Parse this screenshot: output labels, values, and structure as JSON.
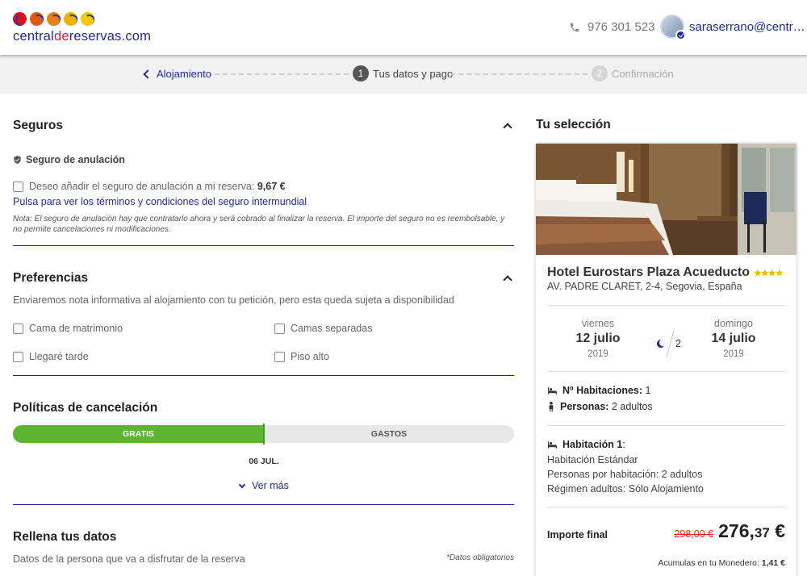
{
  "header": {
    "logo_text_a": "central",
    "logo_text_b": "de",
    "logo_text_c": "reservas.com",
    "phone": "976 301 523",
    "user_email": "saraserrano@centr…"
  },
  "steps": {
    "back_label": "Alojamiento",
    "step1_num": "1",
    "step1_label": "Tus datos y pago",
    "step2_num": "2",
    "step2_label": "Confirmación"
  },
  "seguros": {
    "title": "Seguros",
    "subtitle": "Seguro de anulación",
    "checkbox_label": "Deseo añadir el seguro de anulación a mi reserva:",
    "price": "9,67 €",
    "terms_link": "Pulsa para ver los términos y condiciones del seguro intermundial",
    "note": "Nota: El seguro de anulación hay que contratarlo ahora y será cobrado al finalizar la reserva. El importe del seguro no es reembolsable, y no permite cancelaciones ni modificaciones."
  },
  "preferencias": {
    "title": "Preferencias",
    "description": "Enviaremos nota informativa al alojamiento con tu petición, pero esta queda sujeta a disponibilidad",
    "options": [
      "Cama de matrimonio",
      "Camas separadas",
      "Llegaré tarde",
      "Piso alto"
    ]
  },
  "cancelacion": {
    "title": "Políticas de cancelación",
    "free_label": "GRATIS",
    "cost_label": "GASTOS",
    "free_fraction": 0.5,
    "split_date": "06 JUL.",
    "more_link": "Ver más"
  },
  "datos": {
    "title": "Rellena tus datos",
    "description": "Datos de la persona que va a disfrutar de la reserva",
    "required_note": "*Datos obligatorios"
  },
  "seleccion": {
    "title": "Tu selección",
    "hotel_name": "Hotel Eurostars Plaza Acueducto",
    "stars": "★★★★",
    "star_count": 4,
    "address": "AV. PADRE CLARET, 2-4, Segovia, España",
    "checkin_weekday": "viernes",
    "checkin_date": "12 julio",
    "checkin_year": "2019",
    "nights": "2",
    "checkout_weekday": "domingo",
    "checkout_date": "14 julio",
    "checkout_year": "2019",
    "rooms_label": "Nº Habitaciones:",
    "rooms_value": "1",
    "persons_label": "Personas:",
    "persons_value": "2 adultos",
    "room1_label": "Habitación 1",
    "room1_type": "Habitación Estándar",
    "room1_persons": "Personas por habitación: 2 adultos",
    "room1_regime": "Régimen adultos: Sólo Alojamiento",
    "final_label": "Importe final",
    "old_price": "298,00 €",
    "price_int": "276,",
    "price_dec": "37",
    "price_cur": "€",
    "wallet_label": "Acumulas en tu Monedero:",
    "wallet_value": "1,41 €"
  },
  "colors": {
    "brand_blue": "#1f2a9c",
    "brand_red": "#e31f26",
    "green": "#5cb531",
    "star": "#f2b705"
  }
}
